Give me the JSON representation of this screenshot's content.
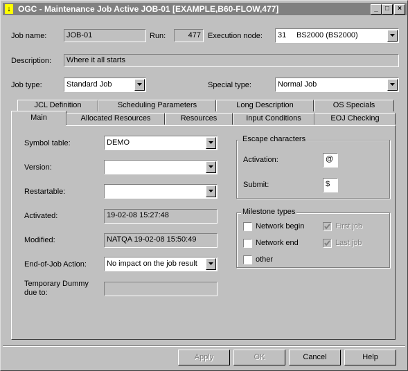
{
  "window": {
    "title": "OGC - Maintenance Job Active JOB-01 [EXAMPLE,B60-FLOW,477]",
    "app_icon": "↓",
    "minimize": "_",
    "maximize": "□",
    "close": "×"
  },
  "header": {
    "job_name_label": "Job name:",
    "job_name_value": "JOB-01",
    "run_label": "Run:",
    "run_value": "477",
    "exec_node_label": "Execution node:",
    "exec_node_number": "31",
    "exec_node_value": "BS2000 (BS2000)",
    "description_label": "Description:",
    "description_value": "Where it all starts",
    "job_type_label": "Job type:",
    "job_type_value": "Standard Job",
    "special_type_label": "Special type:",
    "special_type_value": "Normal Job"
  },
  "tabs": {
    "row1": [
      "JCL Definition",
      "Scheduling Parameters",
      "Long Description",
      "OS Specials"
    ],
    "row2": [
      "Main",
      "Allocated Resources",
      "Resources",
      "Input Conditions",
      "EOJ Checking"
    ],
    "active": "Main"
  },
  "main": {
    "symbol_table_label": "Symbol table:",
    "symbol_table_value": "DEMO",
    "version_label": "Version:",
    "version_value": "",
    "restartable_label": "Restartable:",
    "restartable_value": "",
    "activated_label": "Activated:",
    "activated_value": "19-02-08 15:27:48",
    "modified_label": "Modified:",
    "modified_value": "NATQA 19-02-08 15:50:49",
    "eoj_action_label": "End-of-Job Action:",
    "eoj_action_value": "No impact on the job result",
    "temp_dummy_label_1": "Temporary Dummy",
    "temp_dummy_label_2": "due to:",
    "temp_dummy_value": ""
  },
  "escape": {
    "title": "Escape characters",
    "activation_label": "Activation:",
    "activation_value": "@",
    "submit_label": "Submit:",
    "submit_value": "$"
  },
  "milestone": {
    "title": "Milestone types",
    "network_begin": "Network begin",
    "network_end": "Network end",
    "other": "other",
    "first_job": "First job",
    "last_job": "Last job"
  },
  "buttons": {
    "apply": "Apply",
    "ok": "OK",
    "cancel": "Cancel",
    "help": "Help"
  }
}
